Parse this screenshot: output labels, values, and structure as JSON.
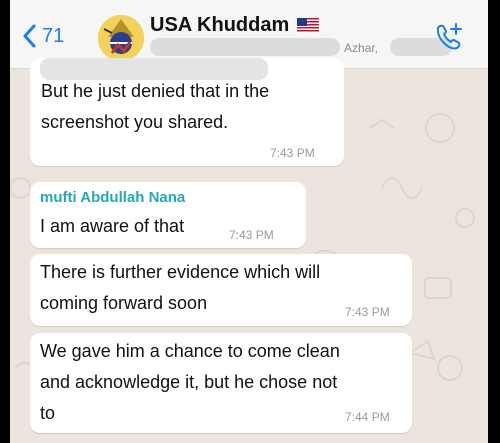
{
  "header": {
    "back_count": "71",
    "chat_title": "USA Khuddam",
    "flag_icon": "us-flag-icon",
    "members_visible": "Azhar,"
  },
  "messages": [
    {
      "sender": "",
      "text": "But he just denied that in the\nscreenshot you shared.",
      "time": "7:43 PM"
    },
    {
      "sender": "mufti Abdullah Nana",
      "sender_color": "#26a8b8",
      "text": "I am aware of that",
      "time": "7:43 PM"
    },
    {
      "sender": "",
      "text": "There is further evidence which will\ncoming forward soon",
      "time": "7:43 PM"
    },
    {
      "sender": "",
      "text": "We gave him a chance to come clean\nand acknowledge it, but he chose not\nto",
      "time": "7:44 PM"
    }
  ],
  "colors": {
    "accent": "#1a7df0",
    "chat_background": "#ece5dd",
    "bubble": "#ffffff"
  }
}
